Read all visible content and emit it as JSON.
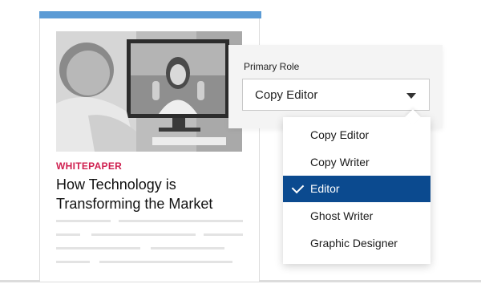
{
  "card": {
    "label": "WHITEPAPER",
    "title_line1": "How Technology is",
    "title_line2": "Transforming the Market",
    "accent_color": "#cf1f4f",
    "top_bar_color": "#5b9bd5",
    "image_icon": "video-call-photo"
  },
  "role_selector": {
    "label": "Primary Role",
    "selected_value": "Copy Editor",
    "options": [
      {
        "label": "Copy Editor",
        "selected": false
      },
      {
        "label": "Copy Writer",
        "selected": false
      },
      {
        "label": "Editor",
        "selected": true
      },
      {
        "label": "Ghost Writer",
        "selected": false
      },
      {
        "label": "Graphic Designer",
        "selected": false
      }
    ],
    "highlight_color": "#0b4a8f",
    "caret_icon": "chevron-down-icon",
    "check_icon": "check-icon"
  }
}
